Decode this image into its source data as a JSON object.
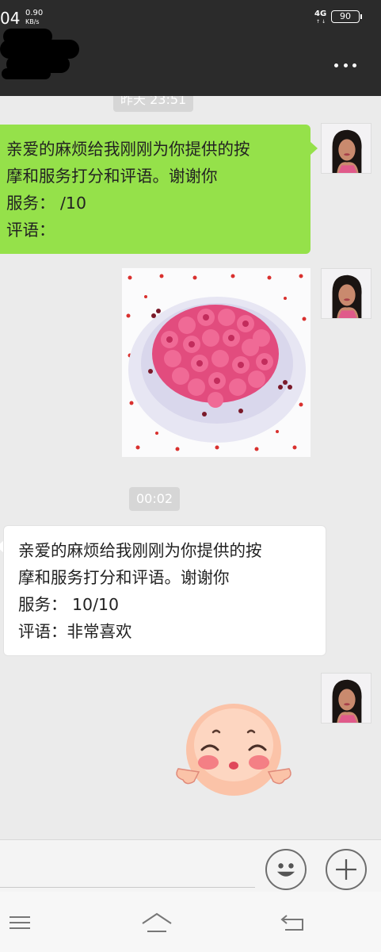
{
  "status_bar": {
    "time": "04",
    "speed_value": "0.90",
    "speed_unit": "KB/s",
    "network": "4G",
    "battery": "90"
  },
  "header": {
    "title_redacted": true,
    "more_icon": "more-dots-icon"
  },
  "messages": [
    {
      "type": "time",
      "text": "昨天 23:51"
    },
    {
      "type": "text",
      "side": "right",
      "color": "#95e14a",
      "lines": [
        "亲爱的麻烦给我刚刚为你提供的按",
        "摩和服务打分和评语。谢谢你",
        "服务：  /10",
        "评语："
      ]
    },
    {
      "type": "image",
      "side": "right",
      "icon": "rose-bouquet-image"
    },
    {
      "type": "time",
      "text": "00:02"
    },
    {
      "type": "text",
      "side": "left",
      "color": "#ffffff",
      "lines": [
        "亲爱的麻烦给我刚刚为你提供的按",
        "摩和服务打分和评语。谢谢你",
        "服务：  10/10",
        "评语：非常喜欢"
      ]
    },
    {
      "type": "sticker",
      "side": "right",
      "icon": "blushing-baby-sticker"
    }
  ],
  "input_bar": {
    "placeholder": "",
    "emoji_icon": "emoji-icon",
    "plus_icon": "plus-icon"
  },
  "nav_bar": {
    "menu_icon": "menu-icon",
    "home_icon": "home-icon",
    "back_icon": "back-icon"
  },
  "colors": {
    "title_bar": "#2b2b2b",
    "chat_background": "#ebebeb",
    "sent_bubble": "#95e14a",
    "received_bubble": "#ffffff",
    "time_chip": "#d6d6d6"
  }
}
